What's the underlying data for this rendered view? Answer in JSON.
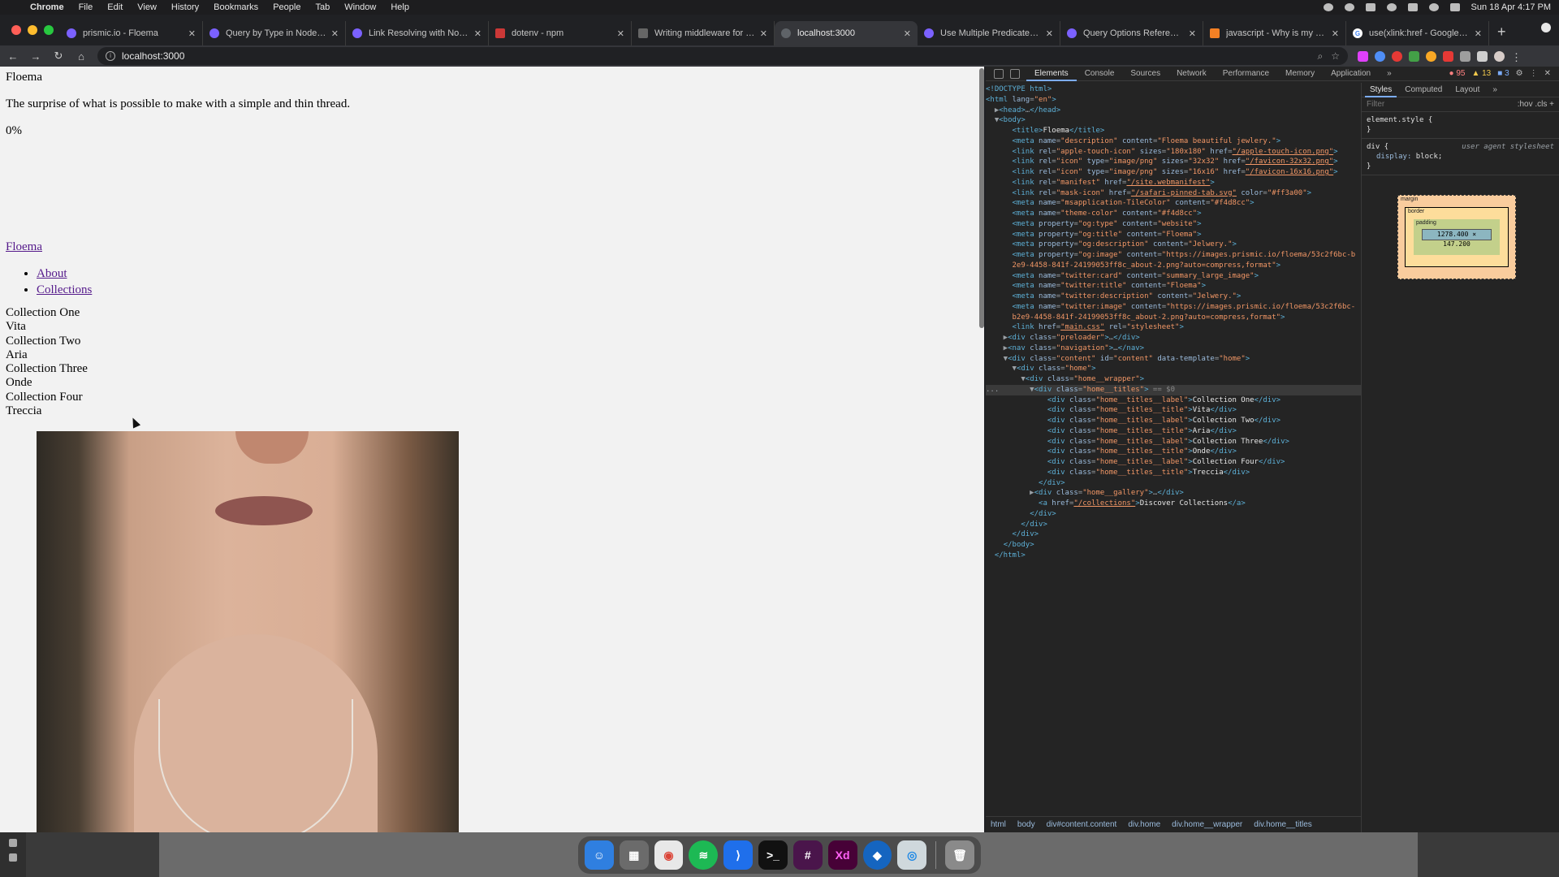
{
  "menubar": {
    "app": "Chrome",
    "items": [
      "File",
      "Edit",
      "View",
      "History",
      "Bookmarks",
      "People",
      "Tab",
      "Window",
      "Help"
    ],
    "datetime": "Sun 18 Apr  4:17 PM"
  },
  "tabs": [
    {
      "title": "prismic.io - Floema",
      "icon": "prismic-icon"
    },
    {
      "title": "Query by Type in Node.js - Pr",
      "icon": "prismic-icon"
    },
    {
      "title": "Link Resolving with Node.js -",
      "icon": "prismic-icon"
    },
    {
      "title": "dotenv - npm",
      "icon": "npm-icon"
    },
    {
      "title": "Writing middleware for use in",
      "icon": "express-icon"
    },
    {
      "title": "localhost:3000",
      "icon": "page-icon"
    },
    {
      "title": "Use Multiple Predicates in Ja",
      "icon": "prismic-icon"
    },
    {
      "title": "Query Options Reference in J",
      "icon": "prismic-icon"
    },
    {
      "title": "javascript - Why is my middl",
      "icon": "stackoverflow-icon"
    },
    {
      "title": "use(xlink:href - Google Searc",
      "icon": "google-icon"
    }
  ],
  "address": {
    "url": "localhost:3000"
  },
  "page": {
    "title": "Floema",
    "description": "The surprise of what is possible to make with a simple and thin thread.",
    "preloader": "0%",
    "logo": "Floema",
    "nav": [
      "About",
      "Collections"
    ],
    "titles": [
      "Collection One",
      "Vita",
      "Collection Two",
      "Aria",
      "Collection Three",
      "Onde",
      "Collection Four",
      "Treccia"
    ]
  },
  "devtools": {
    "tabs": [
      "Elements",
      "Console",
      "Sources",
      "Network",
      "Performance",
      "Memory",
      "Application"
    ],
    "errors": "95",
    "warnings": "13",
    "infos": "3",
    "styles_tabs": [
      "Styles",
      "Computed",
      "Layout"
    ],
    "filter_placeholder": "Filter",
    "filter_right": ":hov  .cls  +",
    "element_style": "element.style {",
    "ua_selector": "div {",
    "ua_source": "user agent stylesheet",
    "ua_prop": "display",
    "ua_val": "block;",
    "box": {
      "margin": "margin",
      "border": "border",
      "padding": "padding",
      "content": "1278.400 × 147.200"
    },
    "breadcrumbs": [
      "html",
      "body",
      "div#content.content",
      "div.home",
      "div.home__wrapper",
      "div.home__titles"
    ]
  }
}
